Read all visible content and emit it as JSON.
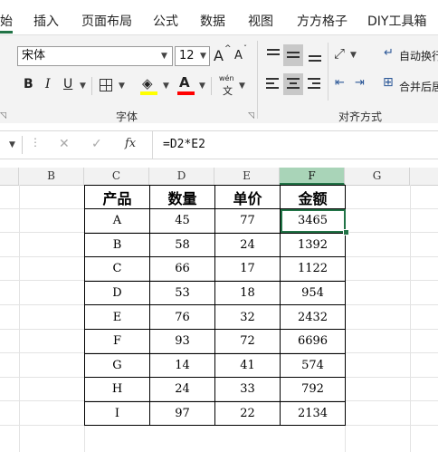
{
  "tabs": [
    "始",
    "插入",
    "页面布局",
    "公式",
    "数据",
    "视图",
    "方方格子",
    "DIY工具箱"
  ],
  "ribbon": {
    "font_name": "宋体",
    "font_size": "12",
    "grow_font": "A",
    "shrink_font": "A",
    "bold": "B",
    "italic": "I",
    "underline": "U",
    "phonetic_top": "wén",
    "phonetic_bottom": "文",
    "font_color_letter": "A",
    "font_group_label": "字体",
    "align_group_label": "对齐方式",
    "wrap_text": "自动换行",
    "merge_center": "合并后居",
    "accent_yellow": "#ffff00",
    "accent_red": "#ff0000"
  },
  "formula_bar": {
    "cancel": "✕",
    "enter": "✓",
    "fx": "fx",
    "formula": "=D2*E2"
  },
  "column_headers": [
    "B",
    "C",
    "D",
    "E",
    "F",
    "G"
  ],
  "table": {
    "headers": [
      "产品",
      "数量",
      "单价",
      "金额"
    ],
    "rows": [
      [
        "A",
        "45",
        "77",
        "3465"
      ],
      [
        "B",
        "58",
        "24",
        "1392"
      ],
      [
        "C",
        "66",
        "17",
        "1122"
      ],
      [
        "D",
        "53",
        "18",
        "954"
      ],
      [
        "E",
        "76",
        "32",
        "2432"
      ],
      [
        "F",
        "93",
        "72",
        "6696"
      ],
      [
        "G",
        "14",
        "41",
        "574"
      ],
      [
        "H",
        "24",
        "33",
        "792"
      ],
      [
        "I",
        "97",
        "22",
        "2134"
      ]
    ]
  },
  "colors": {
    "excel_green": "#217346",
    "selected_header": "#a9d4b8"
  }
}
